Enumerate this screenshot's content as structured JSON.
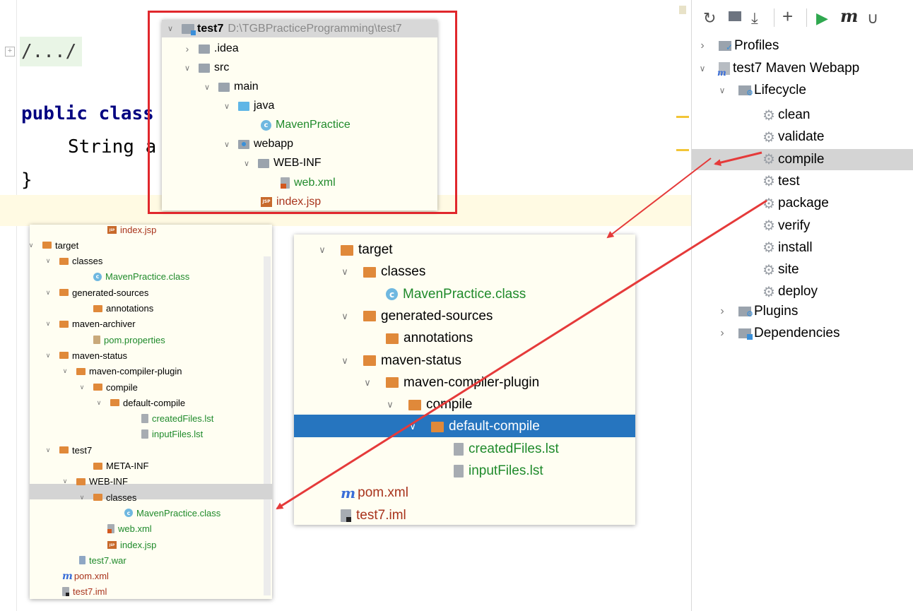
{
  "editor": {
    "fold_text": "/.../",
    "line_class": "public class",
    "line_string": "String a",
    "line_brace": "}"
  },
  "popup_top": {
    "root_name": "test7",
    "root_path": "D:\\TGBPracticeProgramming\\test7",
    "items": [
      ".idea",
      "src",
      "main",
      "java",
      "MavenPractice",
      "webapp",
      "WEB-INF",
      "web.xml",
      "index.jsp"
    ]
  },
  "popup_left": {
    "items": [
      "index.jsp",
      "target",
      "classes",
      "MavenPractice.class",
      "generated-sources",
      "annotations",
      "maven-archiver",
      "pom.properties",
      "maven-status",
      "maven-compiler-plugin",
      "compile",
      "default-compile",
      "createdFiles.lst",
      "inputFiles.lst",
      "test7",
      "META-INF",
      "WEB-INF",
      "classes",
      "MavenPractice.class",
      "web.xml",
      "index.jsp",
      "test7.war",
      "pom.xml",
      "test7.iml"
    ]
  },
  "popup_mid": {
    "items": [
      "target",
      "classes",
      "MavenPractice.class",
      "generated-sources",
      "annotations",
      "maven-status",
      "maven-compiler-plugin",
      "compile",
      "default-compile",
      "createdFiles.lst",
      "inputFiles.lst",
      "pom.xml",
      "test7.iml"
    ]
  },
  "maven": {
    "toolbar_icons": [
      "refresh-icon",
      "reimport-icon",
      "download-icon",
      "add-icon",
      "run-icon",
      "maven-goal-icon",
      "toggle-offline-icon"
    ],
    "profiles": "Profiles",
    "project": "test7 Maven Webapp",
    "lifecycle": "Lifecycle",
    "goals": [
      "clean",
      "validate",
      "compile",
      "test",
      "package",
      "verify",
      "install",
      "site",
      "deploy"
    ],
    "plugins": "Plugins",
    "dependencies": "Dependencies",
    "selected_goal": "compile"
  },
  "colors": {
    "accent_red": "#e53a3a",
    "selection_blue": "#2675bf",
    "selected_grey": "#d4d4d4",
    "file_green": "#1f8a2b"
  }
}
